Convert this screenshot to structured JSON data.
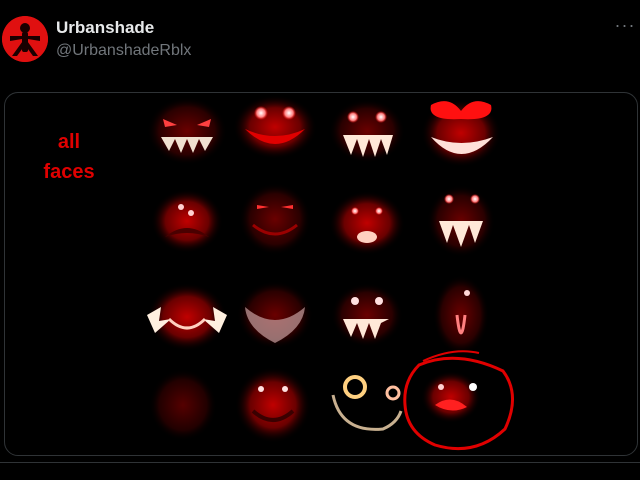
{
  "post": {
    "author": {
      "display_name": "Urbanshade",
      "handle": "@UrbanshadeRblx"
    },
    "more_icon": "more-horizontal-icon"
  },
  "media": {
    "caption_lines": [
      "all",
      "faces"
    ],
    "caption_color": "#e00000",
    "faces": [
      {
        "row": 1,
        "col": 1,
        "style": "jagged grin, narrow eyes"
      },
      {
        "row": 1,
        "col": 2,
        "style": "glowing eyes, wide red mouth"
      },
      {
        "row": 1,
        "col": 3,
        "style": "glowing eyes, toothy grin"
      },
      {
        "row": 1,
        "col": 4,
        "style": "big red bow, wide grin"
      },
      {
        "row": 2,
        "col": 1,
        "style": "small eyes, frowning mouth"
      },
      {
        "row": 2,
        "col": 2,
        "style": "dark slit eyes, smile"
      },
      {
        "row": 2,
        "col": 3,
        "style": "glowing eyes, open mouth"
      },
      {
        "row": 2,
        "col": 4,
        "style": "bright eyes, fanged grin"
      },
      {
        "row": 3,
        "col": 1,
        "style": "grin with white hands"
      },
      {
        "row": 3,
        "col": 2,
        "style": "pale smeared grin"
      },
      {
        "row": 3,
        "col": 3,
        "style": "glowing eyes, jagged grin"
      },
      {
        "row": 3,
        "col": 4,
        "style": "tall narrow face"
      },
      {
        "row": 4,
        "col": 1,
        "style": "dim faded face"
      },
      {
        "row": 4,
        "col": 2,
        "style": "small eyes, dark mouth"
      },
      {
        "row": 4,
        "col": 3,
        "style": "ringed eye, curved line"
      },
      {
        "row": 4,
        "col": 4,
        "style": "circled face, two dots"
      }
    ],
    "highlight": "red circle around bottom-right face"
  }
}
